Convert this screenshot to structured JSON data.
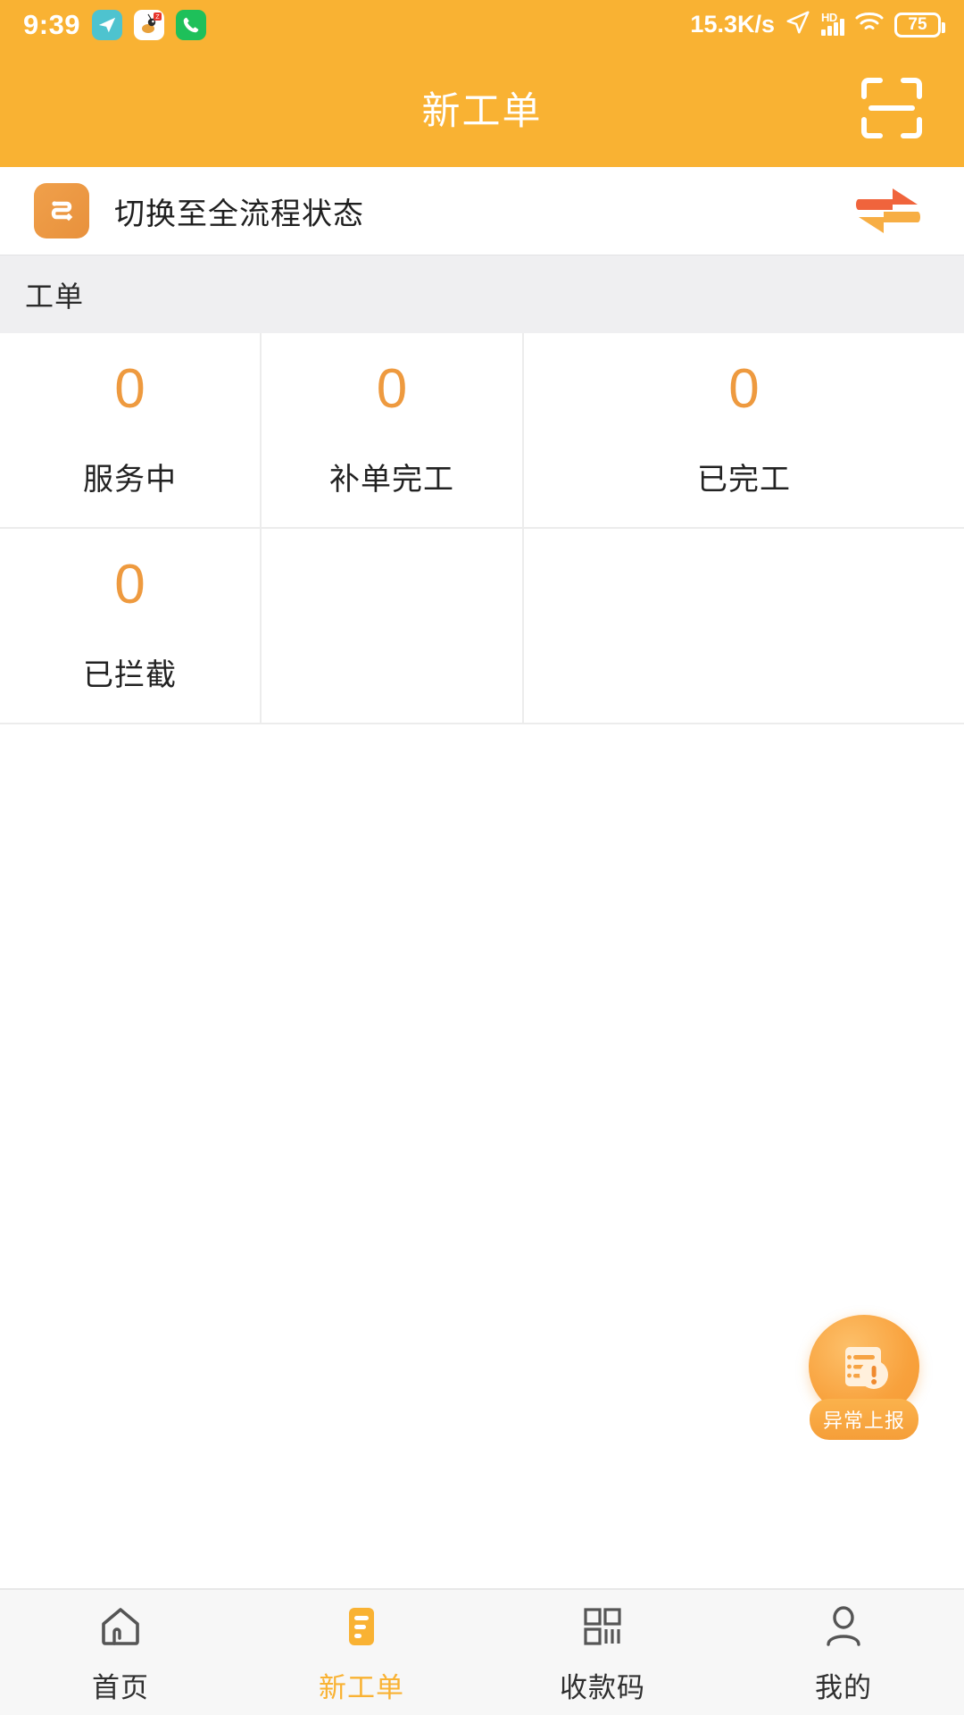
{
  "status_bar": {
    "time": "9:39",
    "app_icons": [
      "telegram-icon",
      "ant-app-icon",
      "phone-icon"
    ],
    "network_speed": "15.3K/s",
    "signal_label": "HD",
    "battery_percent": "75",
    "icons": [
      "location-arrow-icon",
      "signal-bars-icon",
      "wifi-icon",
      "battery-icon"
    ]
  },
  "header": {
    "title": "新工单",
    "scan_icon": "scan-qr-icon",
    "accent_color": "#F9B233"
  },
  "switch_row": {
    "icon": "flow-switch-icon",
    "label": "切换至全流程状态",
    "swap_icon": "swap-arrows-icon"
  },
  "section": {
    "title": "工单"
  },
  "stats": [
    {
      "value": "0",
      "label": "服务中"
    },
    {
      "value": "0",
      "label": "补单完工"
    },
    {
      "value": "0",
      "label": "已完工"
    },
    {
      "value": "0",
      "label": "已拦截"
    },
    {
      "value": "",
      "label": ""
    },
    {
      "value": "",
      "label": ""
    }
  ],
  "fab": {
    "label": "异常上报",
    "icon": "document-alert-icon"
  },
  "bottom_nav": [
    {
      "label": "首页",
      "icon": "home-icon",
      "active": false
    },
    {
      "label": "新工单",
      "icon": "worksheet-icon",
      "active": true
    },
    {
      "label": "收款码",
      "icon": "qr-code-icon",
      "active": false
    },
    {
      "label": "我的",
      "icon": "person-icon",
      "active": false
    }
  ],
  "colors": {
    "brand_orange": "#F9B233",
    "value_orange": "#EE9A3F",
    "section_bg": "#EFEFF1"
  }
}
